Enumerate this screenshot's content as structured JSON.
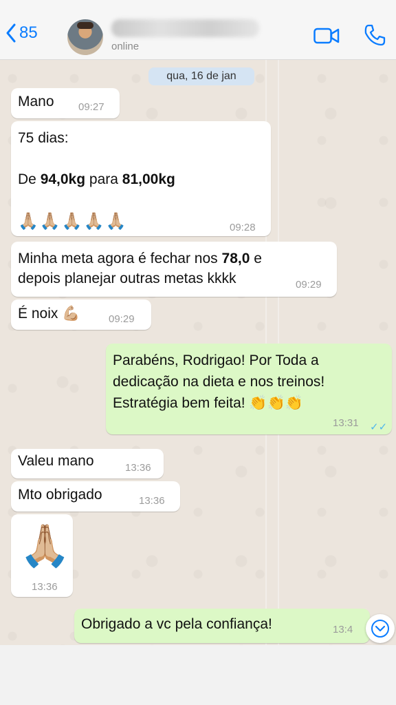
{
  "header": {
    "back_count": "85",
    "contact_name": "",
    "status": "online"
  },
  "chat": {
    "date": "qua, 16 de jan",
    "messages": [
      {
        "text": "Mano",
        "time": "09:27"
      },
      {
        "line1": "75 dias:",
        "line2_pre": "De ",
        "weight1": "94,0kg",
        "line2_mid": " para ",
        "weight2": "81,00kg",
        "emojis": "🙏🏼🙏🏼🙏🏼🙏🏼🙏🏼",
        "time": "09:28"
      },
      {
        "line1_pre": "Minha meta agora é fechar nos ",
        "target": "78,0",
        "line1_post": " e",
        "line2": "depois planejar outras metas kkkk",
        "time": "09:29"
      },
      {
        "text": "É noix 💪🏼",
        "time": "09:29"
      },
      {
        "line1": "Parabéns, Rodrigao! Por Toda a",
        "line2": "dedicação na dieta e nos treinos!",
        "line3": "Estratégia bem feita! 👏👏👏",
        "time": "13:31",
        "ticks": "✓✓"
      },
      {
        "text": "Valeu mano",
        "time": "13:36"
      },
      {
        "text": "Mto obrigado",
        "time": "13:36"
      },
      {
        "emoji": "🙏🏼",
        "time": "13:36"
      },
      {
        "text": "Obrigado a vc pela confiança!",
        "time": "13:4"
      }
    ]
  },
  "colors": {
    "accent": "#0a7cff",
    "incoming_bubble": "#ffffff",
    "outgoing_bubble": "#dcf8c6",
    "chat_background": "#ece5dd",
    "read_ticks": "#4fb6ec"
  },
  "icons": [
    "back-chevron-icon",
    "video-call-icon",
    "phone-icon",
    "scroll-down-icon"
  ]
}
